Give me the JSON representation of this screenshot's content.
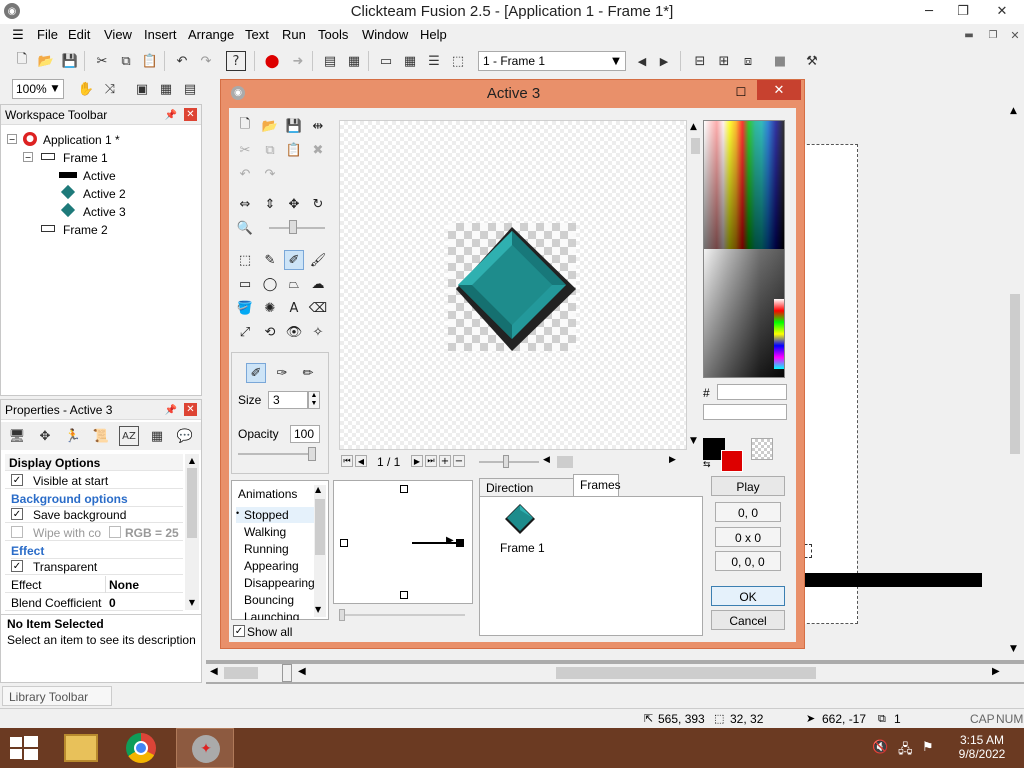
{
  "window": {
    "title": "Clickteam Fusion 2.5 - [Application 1 - Frame 1*]"
  },
  "menu": [
    "File",
    "Edit",
    "View",
    "Insert",
    "Arrange",
    "Text",
    "Run",
    "Tools",
    "Window",
    "Help"
  ],
  "toolbar": {
    "frame_select": "1 - Frame 1",
    "zoom": "100%"
  },
  "workspace": {
    "title": "Workspace Toolbar",
    "items": [
      {
        "label": "Application 1 *",
        "icon": "app-icon"
      },
      {
        "label": "Frame 1",
        "icon": "frame-icon"
      },
      {
        "label": "Active",
        "icon": "active-black-icon"
      },
      {
        "label": "Active 2",
        "icon": "diamond-icon"
      },
      {
        "label": "Active 3",
        "icon": "diamond-icon"
      },
      {
        "label": "Frame 2",
        "icon": "frame-icon"
      }
    ]
  },
  "properties": {
    "title": "Properties - Active 3",
    "rows": {
      "display_options": "Display Options",
      "visible_at_start": "Visible at start",
      "background_options": "Background options",
      "save_background": "Save background",
      "wipe_with_color": "Wipe with co",
      "rgb": "RGB = 25",
      "effect_section": "Effect",
      "transparent": "Transparent",
      "effect_label": "Effect",
      "effect_value": "None",
      "blend_label": "Blend Coefficient",
      "blend_value": "0"
    },
    "desc_title": "No Item Selected",
    "desc_text": "Select an item to see its description"
  },
  "library": {
    "title": "Library Toolbar"
  },
  "statusbar": {
    "pos": "565, 393",
    "size": "32, 32",
    "cursor": "662, -17",
    "layer": "1",
    "caps": "CAP",
    "num": "NUM"
  },
  "dialog": {
    "title": "Active 3",
    "size_label": "Size",
    "size_value": "3",
    "opacity_label": "Opacity",
    "opacity_value": "100",
    "frame_counter": "1 / 1",
    "animations_header": "Animations",
    "animations": [
      "Stopped",
      "Walking",
      "Running",
      "Appearing",
      "Disappearing",
      "Bouncing",
      "Launching"
    ],
    "show_all": "Show all",
    "tabs": {
      "direction": "Direction Options",
      "frames": "Frames"
    },
    "frame_item": "Frame 1",
    "hash": "#",
    "play": "Play",
    "hotspot": "0, 0",
    "dim": "0 x 0",
    "rgb": "0, 0, 0",
    "ok": "OK",
    "cancel": "Cancel",
    "colors": {
      "accent": "#e9906a",
      "diamond": "#1e8c8c",
      "fg": "#000000",
      "bg": "#dd0000"
    }
  },
  "taskbar": {
    "time": "3:15 AM",
    "date": "9/8/2022"
  }
}
